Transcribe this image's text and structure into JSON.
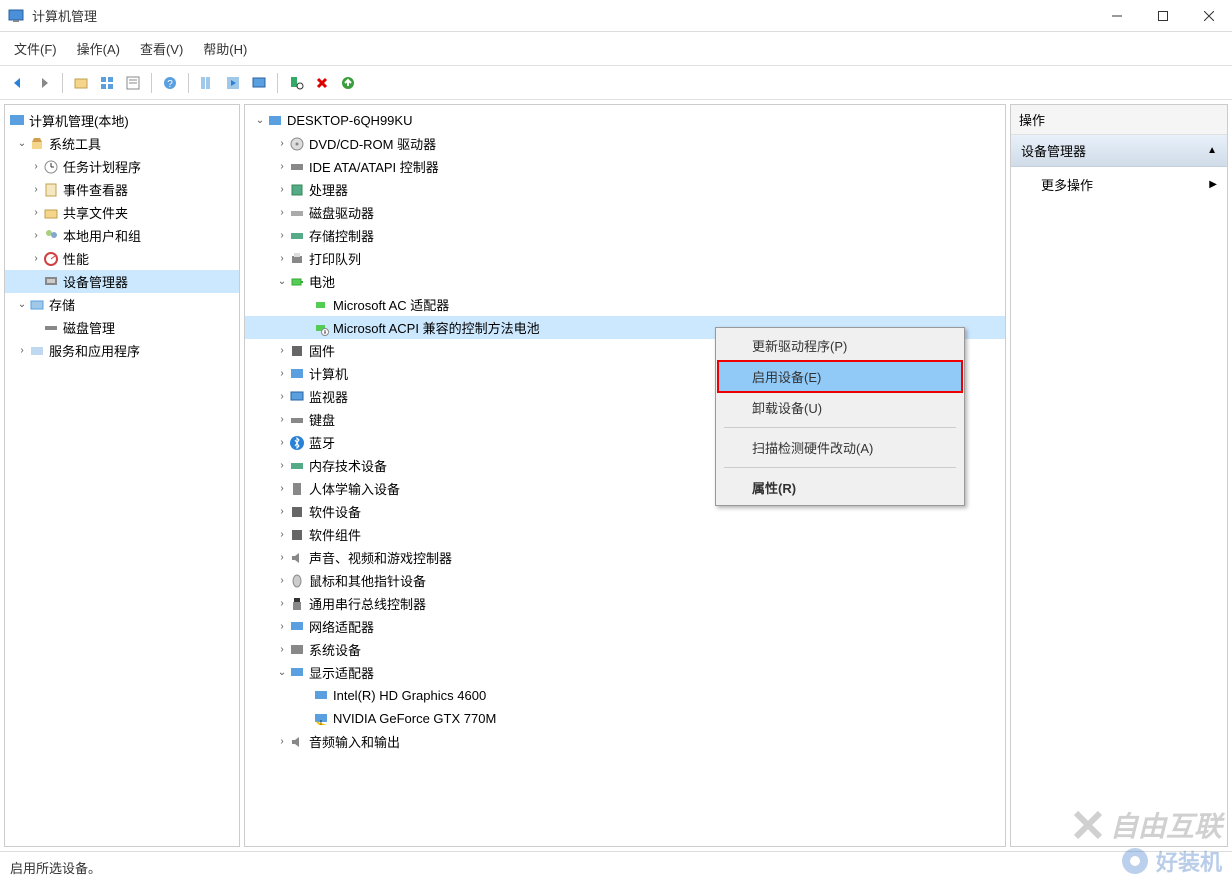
{
  "window": {
    "title": "计算机管理"
  },
  "menubar": [
    "文件(F)",
    "操作(A)",
    "查看(V)",
    "帮助(H)"
  ],
  "left_tree": {
    "root": "计算机管理(本地)",
    "sys_tools": "系统工具",
    "task_sched": "任务计划程序",
    "event_viewer": "事件查看器",
    "shared_folders": "共享文件夹",
    "local_users": "本地用户和组",
    "perf": "性能",
    "dev_mgr": "设备管理器",
    "storage": "存储",
    "disk_mgmt": "磁盘管理",
    "services": "服务和应用程序"
  },
  "devices": {
    "root": "DESKTOP-6QH99KU",
    "dvd": "DVD/CD-ROM 驱动器",
    "ide": "IDE ATA/ATAPI 控制器",
    "cpu": "处理器",
    "disk_drives": "磁盘驱动器",
    "storage_ctrl": "存储控制器",
    "print_queues": "打印队列",
    "battery": "电池",
    "ac_adapter": "Microsoft AC 适配器",
    "acpi_battery": "Microsoft ACPI 兼容的控制方法电池",
    "firmware": "固件",
    "computer": "计算机",
    "monitor": "监视器",
    "keyboard": "键盘",
    "bluetooth": "蓝牙",
    "memory": "内存技术设备",
    "hid": "人体学输入设备",
    "software_dev": "软件设备",
    "software_comp": "软件组件",
    "sound": "声音、视频和游戏控制器",
    "mouse": "鼠标和其他指针设备",
    "usb_ctrl": "通用串行总线控制器",
    "network": "网络适配器",
    "system_dev": "系统设备",
    "display": "显示适配器",
    "intel_hd": "Intel(R) HD Graphics 4600",
    "nvidia": "NVIDIA GeForce GTX 770M",
    "audio_io": "音频输入和输出"
  },
  "context_menu": {
    "update_driver": "更新驱动程序(P)",
    "enable_device": "启用设备(E)",
    "uninstall": "卸载设备(U)",
    "scan": "扫描检测硬件改动(A)",
    "properties": "属性(R)"
  },
  "right_pane": {
    "header": "操作",
    "section": "设备管理器",
    "more": "更多操作"
  },
  "statusbar": "启用所选设备。",
  "watermarks": {
    "w1": "自由互联",
    "w2": "好装机"
  }
}
